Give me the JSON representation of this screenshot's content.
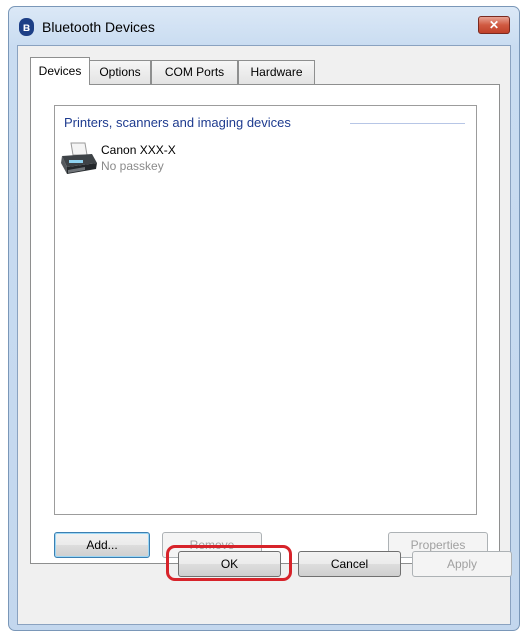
{
  "window": {
    "title": "Bluetooth Devices",
    "close_label": "✕"
  },
  "tabs": [
    {
      "label": "Devices"
    },
    {
      "label": "Options"
    },
    {
      "label": "COM Ports"
    },
    {
      "label": "Hardware"
    }
  ],
  "devices_panel": {
    "group_header": "Printers, scanners and imaging devices",
    "device": {
      "name": "Canon XXX-X",
      "status": "No passkey",
      "icon": "printer-icon"
    }
  },
  "panel_buttons": {
    "add": "Add...",
    "remove": "Remove",
    "properties": "Properties"
  },
  "dialog_buttons": {
    "ok": "OK",
    "cancel": "Cancel",
    "apply": "Apply"
  },
  "colors": {
    "highlight": "#d7232a",
    "group_header": "#1e3b8f",
    "close_button": "#c0402a"
  }
}
